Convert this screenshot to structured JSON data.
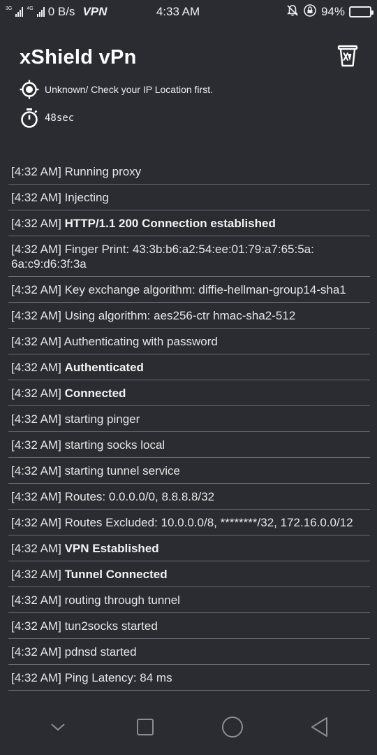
{
  "statusbar": {
    "net_small_1": "3G",
    "net_small_2": "4G",
    "speed": "0 B/s",
    "vpn": "VPN",
    "time": "4:33 AM",
    "battery": "94%",
    "battery_level": 0.94,
    "battery_color": "#3a8ee6"
  },
  "header": {
    "title": "xShield vPn",
    "ip_text": "Unknown/ Check your IP Location first.",
    "timer": "48sec"
  },
  "logs": [
    {
      "time": "[4:32 AM]",
      "msg": "Running proxy",
      "bold": false
    },
    {
      "time": "[4:32 AM]",
      "msg": "Injecting",
      "bold": false
    },
    {
      "time": "[4:32 AM]",
      "msg": "HTTP/1.1 200 Connection established",
      "bold": true
    },
    {
      "time": "[4:32 AM]",
      "msg": "Finger Print: 43:3b:b6:a2:54:ee:01:79:a7:65:5a: 6a:c9:d6:3f:3a",
      "bold": false
    },
    {
      "time": "[4:32 AM]",
      "msg": "Key exchange algorithm: diffie-hellman-group14-sha1",
      "bold": false
    },
    {
      "time": "[4:32 AM]",
      "msg": "Using algorithm: aes256-ctr hmac-sha2-512",
      "bold": false
    },
    {
      "time": "[4:32 AM]",
      "msg": "Authenticating with password",
      "bold": false
    },
    {
      "time": "[4:32 AM]",
      "msg": "Authenticated",
      "bold": true
    },
    {
      "time": "[4:32 AM]",
      "msg": "Connected",
      "bold": true
    },
    {
      "time": "[4:32 AM]",
      "msg": "starting pinger",
      "bold": false
    },
    {
      "time": "[4:32 AM]",
      "msg": "starting socks local",
      "bold": false
    },
    {
      "time": "[4:32 AM]",
      "msg": "starting tunnel service",
      "bold": false
    },
    {
      "time": "[4:32 AM]",
      "msg": "Routes: 0.0.0.0/0, 8.8.8.8/32",
      "bold": false
    },
    {
      "time": "[4:32 AM]",
      "msg": "Routes Excluded: 10.0.0.0/8, ********/32, 172.16.0.0/12",
      "bold": false
    },
    {
      "time": "[4:32 AM]",
      "msg": "VPN Established",
      "bold": true
    },
    {
      "time": "[4:32 AM]",
      "msg": "Tunnel Connected",
      "bold": true
    },
    {
      "time": "[4:32 AM]",
      "msg": "routing through tunnel",
      "bold": false
    },
    {
      "time": "[4:32 AM]",
      "msg": "tun2socks started",
      "bold": false
    },
    {
      "time": "[4:32 AM]",
      "msg": "pdnsd started",
      "bold": false
    },
    {
      "time": "[4:32 AM]",
      "msg": "Ping Latency: 84 ms",
      "bold": false
    }
  ],
  "icons": {
    "clear": "trash-icon",
    "location": "crosshair-icon",
    "timer": "stopwatch-icon",
    "nav_down": "chevron-down-icon",
    "nav_recent": "square-icon",
    "nav_home": "circle-icon",
    "nav_back": "triangle-back-icon"
  }
}
